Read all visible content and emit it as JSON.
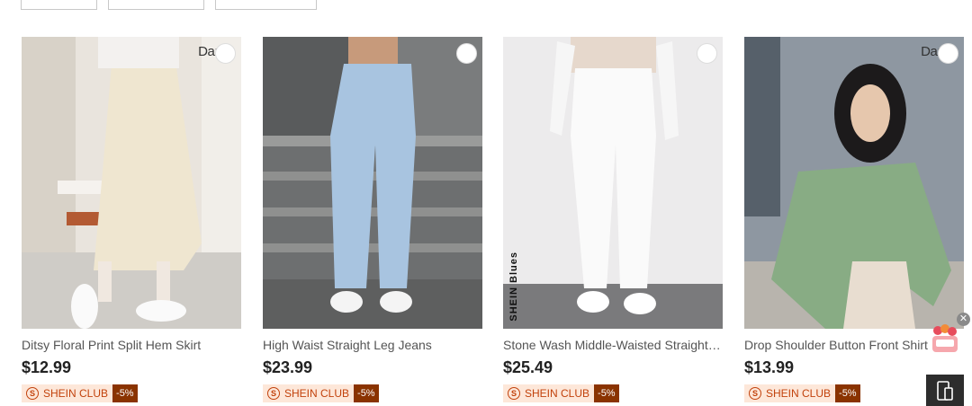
{
  "filters": [
    {
      "name": "filter-button-1"
    },
    {
      "name": "filter-button-2"
    },
    {
      "name": "filter-button-3"
    }
  ],
  "products": [
    {
      "title": "Ditsy Floral Print Split Hem Skirt",
      "price": "$12.99",
      "brand_tag": "Da:",
      "club_label": "SHEIN CLUB",
      "discount": "-5%",
      "side_text": ""
    },
    {
      "title": "High Waist Straight Leg Jeans",
      "price": "$23.99",
      "brand_tag": "",
      "club_label": "SHEIN CLUB",
      "discount": "-5%",
      "side_text": ""
    },
    {
      "title": "Stone Wash Middle-Waisted Straight Leg Jeans",
      "price": "$25.49",
      "brand_tag": "",
      "club_label": "SHEIN CLUB",
      "discount": "-5%",
      "side_text": "SHEIN Blues"
    },
    {
      "title": "Drop Shoulder Button Front Shirt",
      "price": "$13.99",
      "brand_tag": "Da:",
      "club_label": "SHEIN CLUB",
      "discount": "-5%",
      "side_text": ""
    }
  ],
  "widgets": {
    "close_symbol": "✕"
  }
}
